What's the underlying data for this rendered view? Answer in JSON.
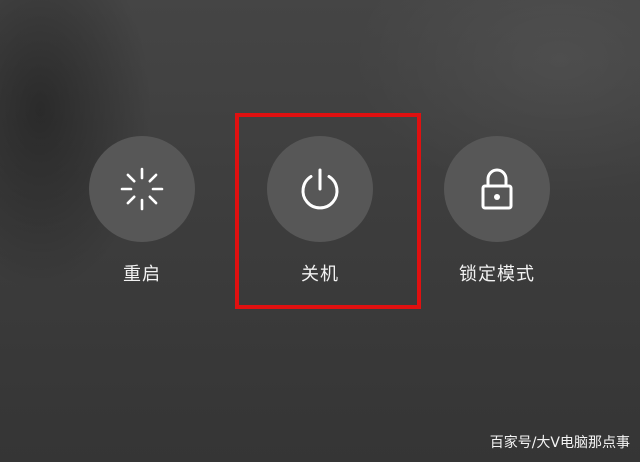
{
  "power_menu": {
    "options": [
      {
        "label": "重启",
        "icon": "restart-spinner-icon"
      },
      {
        "label": "关机",
        "icon": "power-icon"
      },
      {
        "label": "锁定模式",
        "icon": "lock-icon"
      }
    ],
    "highlighted_option": "关机",
    "highlight_color": "#e01010"
  },
  "watermark": "百家号/大V电脑那点事"
}
